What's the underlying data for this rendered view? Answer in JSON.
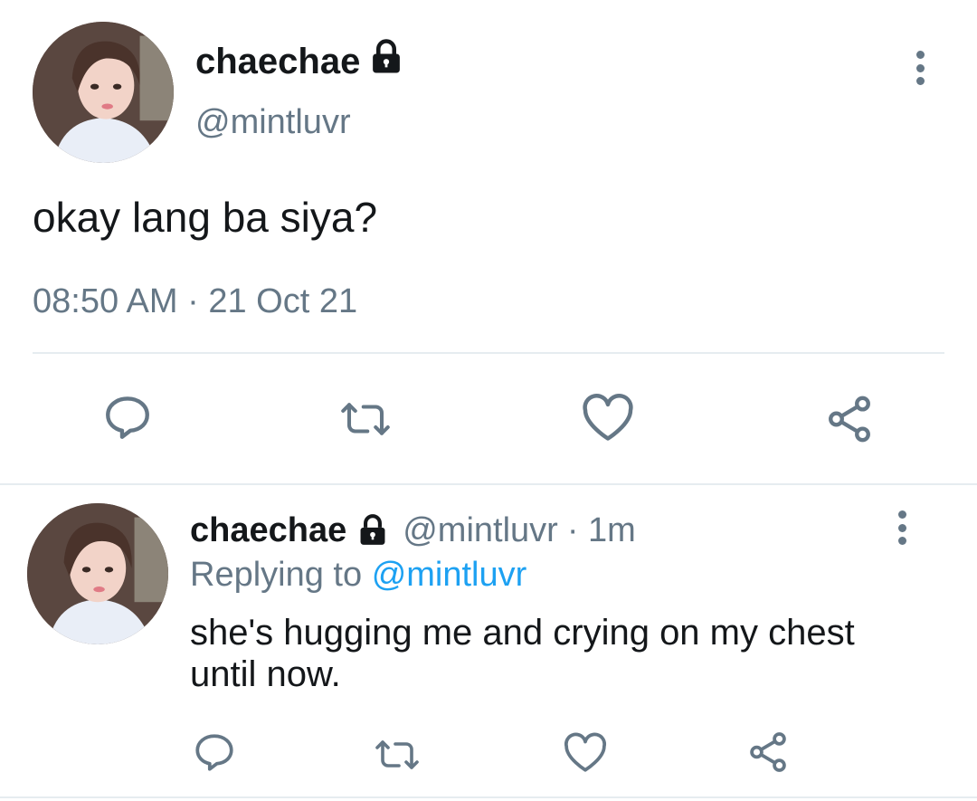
{
  "main_tweet": {
    "display_name": "chaechae",
    "handle": "@mintluvr",
    "text": "okay lang ba siya?",
    "timestamp": "08:50 AM · 21 Oct 21",
    "avatar_icon": "avatar-photo",
    "locked_icon": "lock-icon",
    "actions": [
      "reply-icon",
      "retweet-icon",
      "like-icon",
      "share-icon"
    ]
  },
  "reply_tweet": {
    "display_name": "chaechae",
    "handle": "@mintluvr",
    "time": "· 1m",
    "replying_prefix": "Replying to",
    "replying_handle": "@mintluvr",
    "text_line1": "she's hugging me and crying on my chest",
    "text_line2": "until now.",
    "actions": [
      "reply-icon",
      "retweet-icon",
      "like-icon",
      "share-icon"
    ]
  },
  "colors": {
    "text": "#14171a",
    "muted": "#657786",
    "link": "#1da1f2",
    "divider": "#e6ecf0"
  }
}
